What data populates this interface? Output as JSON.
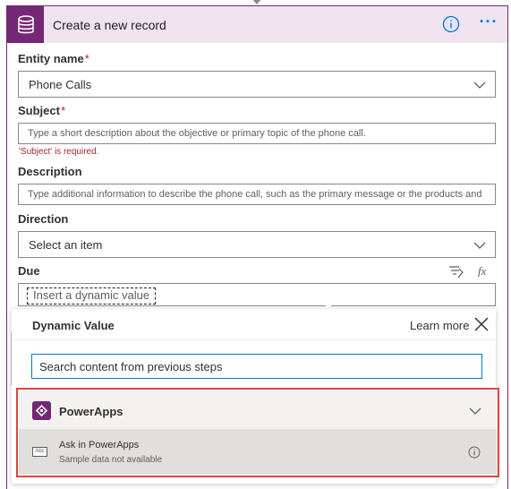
{
  "card": {
    "title": "Create a new record",
    "info_icon": "info-icon",
    "more_icon": "more-ellipsis-icon",
    "more_label": "···",
    "brand_color": "#742774"
  },
  "fields": {
    "entity": {
      "label": "Entity name",
      "required": "*",
      "value": "Phone Calls"
    },
    "subject": {
      "label": "Subject",
      "required": "*",
      "placeholder": "Type a short description about the objective or primary topic of the phone call.",
      "error": "'Subject' is required."
    },
    "description": {
      "label": "Description",
      "placeholder": "Type additional information to describe the phone call, such as the primary message or the products and"
    },
    "direction": {
      "label": "Direction",
      "value": "Select an item"
    },
    "due": {
      "label": "Due",
      "dynamic_chip": "Insert a dynamic value"
    }
  },
  "dynamic_panel": {
    "title": "Dynamic Value",
    "learn_more": "Learn more",
    "search_placeholder": "Search content from previous steps",
    "group": {
      "name": "PowerApps",
      "expanded": true
    },
    "items": [
      {
        "name": "Ask in PowerApps",
        "subtitle": "Sample data not available",
        "icon_text": "Abc"
      }
    ],
    "highlight_color": "#e0443c"
  }
}
